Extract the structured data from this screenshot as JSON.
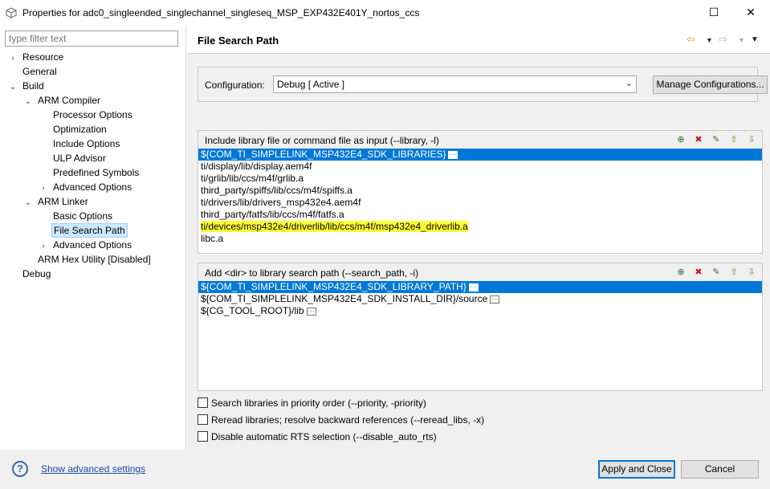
{
  "window": {
    "title": "Properties for adc0_singleended_singlechannel_singleseq_MSP_EXP432E401Y_nortos_ccs",
    "maximize_glyph": "☐",
    "close_glyph": "✕"
  },
  "sidebar": {
    "filter_placeholder": "type filter text",
    "items": [
      {
        "label": "Resource",
        "toggle": "›"
      },
      {
        "label": "General",
        "toggle": ""
      },
      {
        "label": "Build",
        "toggle": "⌄"
      },
      {
        "label": "ARM Compiler",
        "toggle": "⌄"
      },
      {
        "label": "Processor Options",
        "toggle": ""
      },
      {
        "label": "Optimization",
        "toggle": ""
      },
      {
        "label": "Include Options",
        "toggle": ""
      },
      {
        "label": "ULP Advisor",
        "toggle": ""
      },
      {
        "label": "Predefined Symbols",
        "toggle": ""
      },
      {
        "label": "Advanced Options",
        "toggle": "›"
      },
      {
        "label": "ARM Linker",
        "toggle": "⌄"
      },
      {
        "label": "Basic Options",
        "toggle": ""
      },
      {
        "label": "File Search Path",
        "toggle": ""
      },
      {
        "label": "Advanced Options",
        "toggle": "›"
      },
      {
        "label": "ARM Hex Utility  [Disabled]",
        "toggle": ""
      },
      {
        "label": "Debug",
        "toggle": ""
      }
    ]
  },
  "main": {
    "page_title": "File Search Path",
    "configuration": {
      "label": "Configuration:",
      "value": "Debug  [ Active ]",
      "manage_button": "Manage Configurations..."
    },
    "library_panel": {
      "title": "Include library file or command file as input (--library, -l)",
      "items": [
        "${COM_TI_SIMPLELINK_MSP432E4_SDK_LIBRARIES}",
        "ti/display/lib/display.aem4f",
        "ti/grlib/lib/ccs/m4f/grlib.a",
        "third_party/spiffs/lib/ccs/m4f/spiffs.a",
        "ti/drivers/lib/drivers_msp432e4.aem4f",
        "third_party/fatfs/lib/ccs/m4f/fatfs.a",
        "ti/devices/msp432e4/driverlib/lib/ccs/m4f/msp432e4_driverlib.a",
        "libc.a"
      ]
    },
    "search_path_panel": {
      "title": "Add <dir> to library search path (--search_path, -i)",
      "items": [
        "${COM_TI_SIMPLELINK_MSP432E4_SDK_LIBRARY_PATH}",
        "${COM_TI_SIMPLELINK_MSP432E4_SDK_INSTALL_DIR}/source",
        "${CG_TOOL_ROOT}/lib"
      ]
    },
    "options": {
      "priority": "Search libraries in priority order (--priority, -priority)",
      "reread": "Reread libraries; resolve backward references (--reread_libs, -x)",
      "disable_rts": "Disable automatic RTS selection (--disable_auto_rts)"
    },
    "ellipsis": "···"
  },
  "footer": {
    "help_glyph": "?",
    "advanced_link": "Show advanced settings",
    "apply_button": "Apply and Close",
    "cancel_button": "Cancel"
  },
  "icons": {
    "add": "add-icon",
    "delete": "delete-icon",
    "edit": "edit-icon",
    "move_up": "move-up-icon",
    "move_down": "move-down-icon",
    "back": "back-arrow-icon",
    "forward": "forward-arrow-icon",
    "view_menu": "view-menu-icon",
    "help": "help-icon"
  },
  "colors": {
    "selection": "#0078d7",
    "highlight": "#ffff33",
    "tree_selection": "#cce8ff"
  }
}
